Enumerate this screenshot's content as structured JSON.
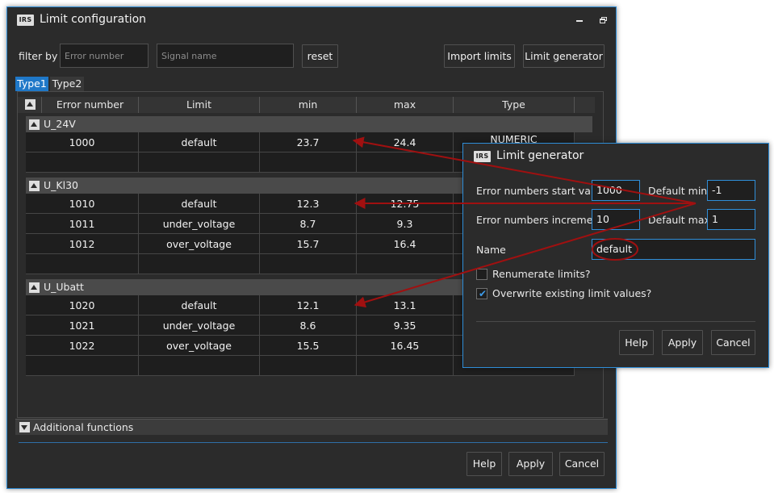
{
  "main_window": {
    "logo": "IRS",
    "title": "Limit configuration",
    "minimize_icon": "minimize-icon",
    "restore_icon": "restore-icon"
  },
  "filter": {
    "label": "filter by",
    "error_number_placeholder": "Error number",
    "signal_name_placeholder": "Signal name",
    "reset_label": "reset",
    "import_label": "Import limits",
    "generator_label": "Limit generator"
  },
  "tabs": [
    {
      "label": "Type1",
      "active": true
    },
    {
      "label": "Type2",
      "active": false
    }
  ],
  "table": {
    "columns": [
      "Error number",
      "Limit",
      "min",
      "max",
      "Type"
    ],
    "groups": [
      {
        "name": "U_24V",
        "rows": [
          {
            "error": "1000",
            "limit": "default",
            "min": "23.7",
            "max": "24.4",
            "type": "NUMERIC"
          }
        ]
      },
      {
        "name": "U_Kl30",
        "rows": [
          {
            "error": "1010",
            "limit": "default",
            "min": "12.3",
            "max": "12.75",
            "type": ""
          },
          {
            "error": "1011",
            "limit": "under_voltage",
            "min": "8.7",
            "max": "9.3",
            "type": ""
          },
          {
            "error": "1012",
            "limit": "over_voltage",
            "min": "15.7",
            "max": "16.4",
            "type": ""
          }
        ]
      },
      {
        "name": "U_Ubatt",
        "rows": [
          {
            "error": "1020",
            "limit": "default",
            "min": "12.1",
            "max": "13.1",
            "type": ""
          },
          {
            "error": "1021",
            "limit": "under_voltage",
            "min": "8.6",
            "max": "9.35",
            "type": ""
          },
          {
            "error": "1022",
            "limit": "over_voltage",
            "min": "15.5",
            "max": "16.45",
            "type": ""
          }
        ]
      }
    ]
  },
  "additional_functions": "Additional functions",
  "footer": {
    "help": "Help",
    "apply": "Apply",
    "cancel": "Cancel"
  },
  "generator_dialog": {
    "logo": "IRS",
    "title": "Limit generator",
    "start_label": "Error numbers start value",
    "start_value": "1000",
    "default_min_label": "Default min",
    "default_min_value": "-1",
    "increment_label": "Error numbers increment",
    "increment_value": "10",
    "default_max_label": "Default max",
    "default_max_value": "1",
    "name_label": "Name",
    "name_value": "default",
    "renumerate_label": "Renumerate limits?",
    "renumerate_checked": false,
    "overwrite_label": "Overwrite existing limit values?",
    "overwrite_checked": true,
    "help": "Help",
    "apply": "Apply",
    "cancel": "Cancel"
  },
  "colors": {
    "accent": "#2f8ed8",
    "annotation": "#a01010",
    "background": "#2b2b2b"
  }
}
